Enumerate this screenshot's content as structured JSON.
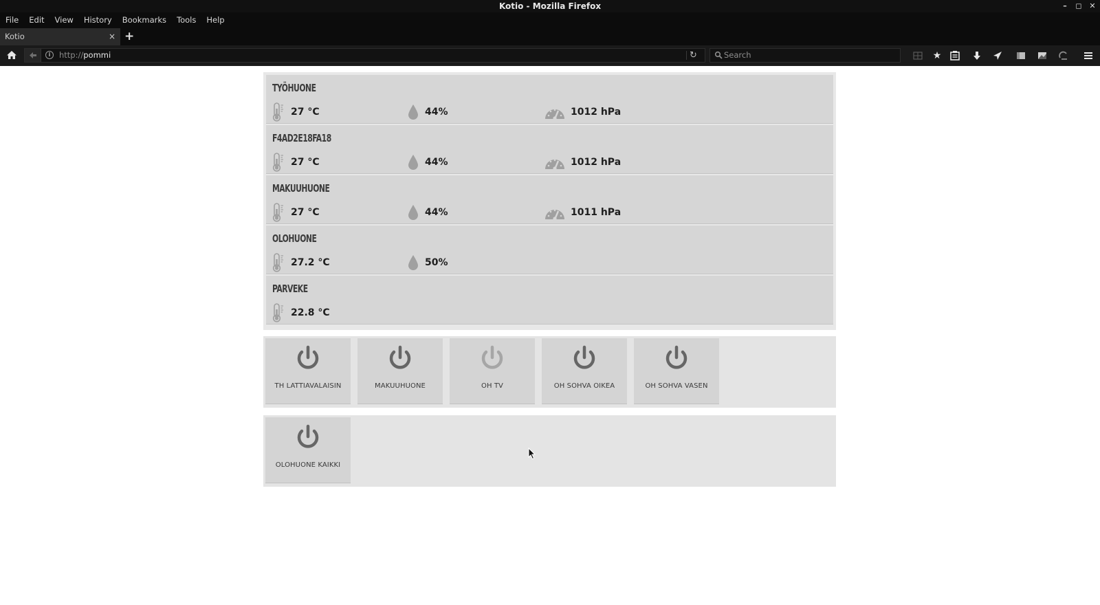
{
  "window": {
    "title": "Kotio - Mozilla Firefox",
    "controls": [
      "–",
      "◻",
      "✕"
    ]
  },
  "menu": [
    "File",
    "Edit",
    "View",
    "History",
    "Bookmarks",
    "Tools",
    "Help"
  ],
  "tab": {
    "title": "Kotio",
    "close": "×",
    "new_tab": "+"
  },
  "navbar": {
    "url_scheme": "http://",
    "url_host": "pommi",
    "search_placeholder": "Search"
  },
  "sensors": [
    {
      "name": "TYÖHUONE",
      "temperature": "27 °C",
      "humidity": "44%",
      "pressure": "1012 hPa"
    },
    {
      "name": "F4AD2E18FA18",
      "temperature": "27 °C",
      "humidity": "44%",
      "pressure": "1012 hPa"
    },
    {
      "name": "MAKUUHUONE",
      "temperature": "27 °C",
      "humidity": "44%",
      "pressure": "1011 hPa"
    },
    {
      "name": "OLOHUONE",
      "temperature": "27.2 °C",
      "humidity": "50%"
    },
    {
      "name": "PARVEKE",
      "temperature": "22.8 °C"
    }
  ],
  "switches": [
    {
      "label": "TH LATTIAVALAISIN",
      "state": "on"
    },
    {
      "label": "MAKUUHUONE",
      "state": "on"
    },
    {
      "label": "OH TV",
      "state": "off"
    },
    {
      "label": "OH SOHVA OIKEA",
      "state": "on"
    },
    {
      "label": "OH SOHVA VASEN",
      "state": "on"
    }
  ],
  "groups": [
    {
      "label": "OLOHUONE KAIKKI",
      "state": "on"
    }
  ],
  "colors": {
    "switch_on_icon": "#666666",
    "switch_off_icon": "#a6a6a6",
    "sensor_icon": "#a0a0a0"
  }
}
